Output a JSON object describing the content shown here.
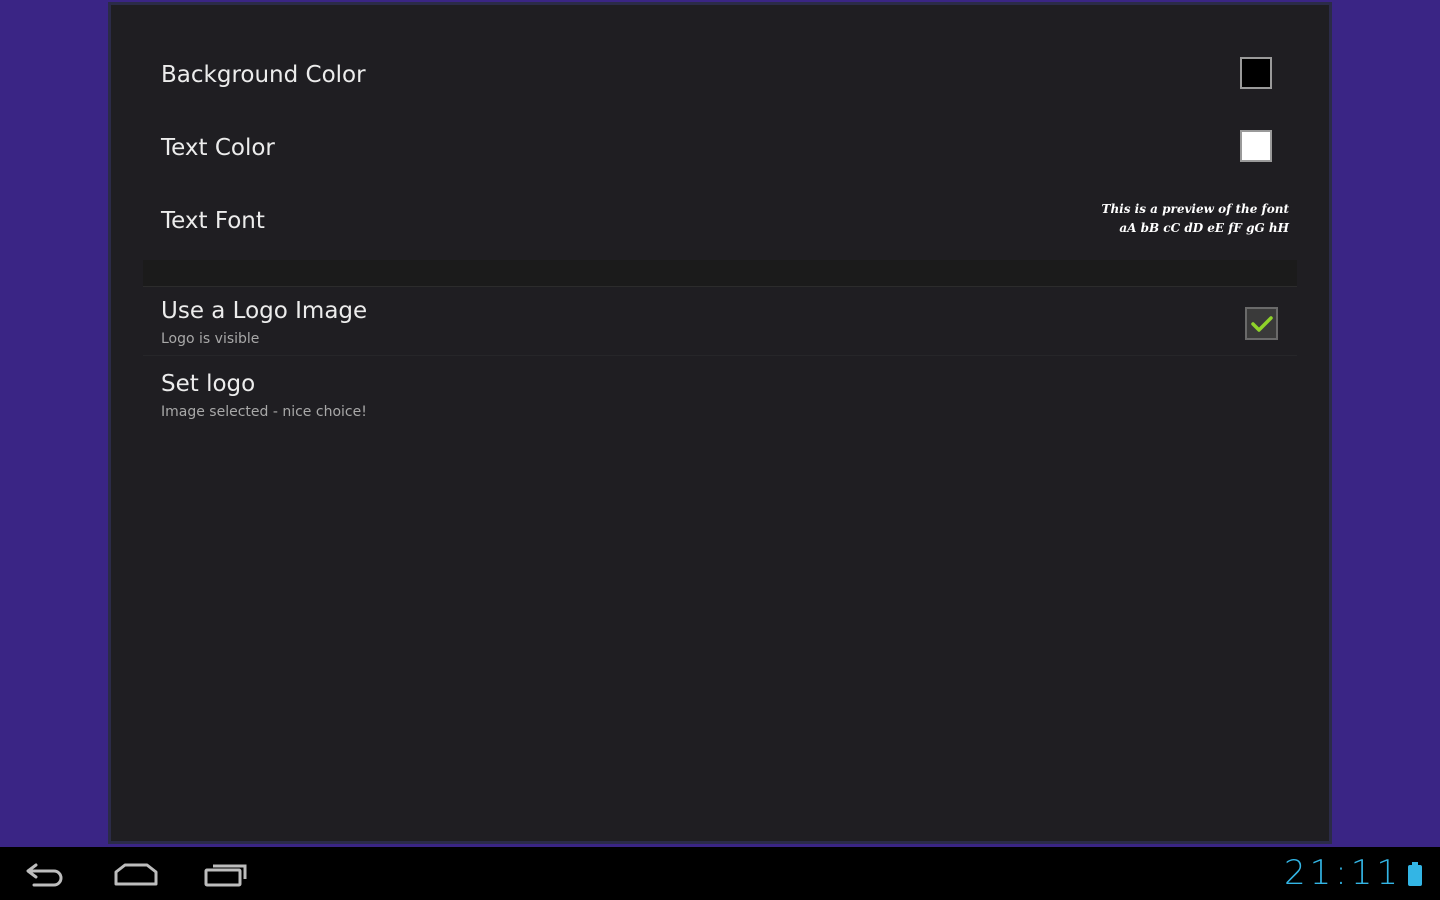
{
  "preferences": {
    "background_color": {
      "title": "Background Color",
      "swatch_color": "#000000"
    },
    "text_color": {
      "title": "Text Color",
      "swatch_color": "#ffffff"
    },
    "text_font": {
      "title": "Text Font",
      "preview_line1": "This is a preview of the font",
      "preview_line2": "aA bB cC dD eE fF gG hH"
    },
    "use_logo": {
      "title": "Use a Logo Image",
      "summary": "Logo is visible",
      "checked": true
    },
    "set_logo": {
      "title": "Set logo",
      "summary": "Image selected - nice choice!"
    }
  },
  "status_bar": {
    "clock": "21:11"
  },
  "navigation": {
    "back_icon": "back-arrow-icon",
    "home_icon": "home-icon",
    "recents_icon": "recent-apps-icon"
  },
  "colors": {
    "background_accent": "#3a2585",
    "dialog_bg": "#1f1e22",
    "clock_color": "#33b5e5",
    "check_color": "#8fd32a"
  }
}
